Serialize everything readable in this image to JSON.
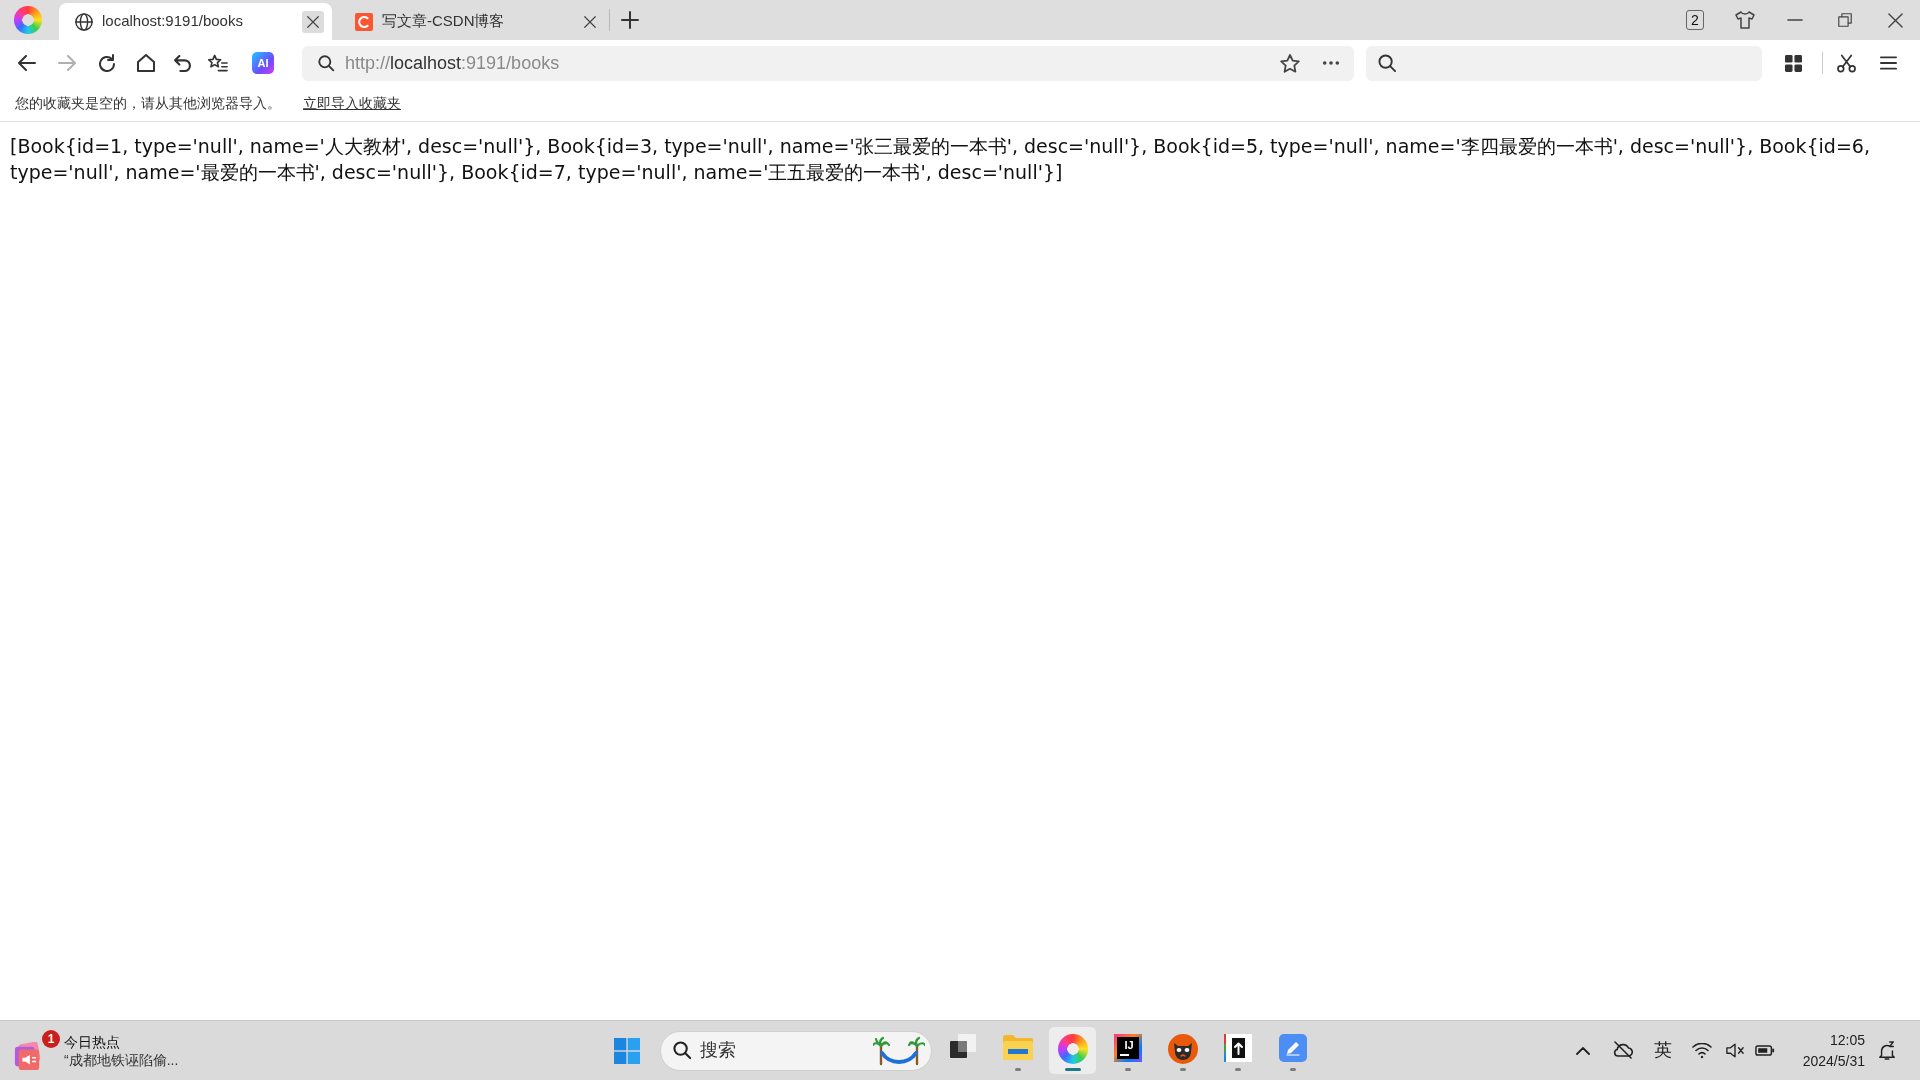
{
  "browser": {
    "tabs": [
      {
        "kind": "globe",
        "title": "localhost:9191/books",
        "selected": true
      },
      {
        "kind": "c-logo",
        "title": "写文章-CSDN博客",
        "selected": false
      }
    ],
    "window_controls": {
      "tab_count": "2"
    },
    "toolbar": {
      "buttons": [
        {
          "kind": "back",
          "disabled": false
        },
        {
          "kind": "forward",
          "disabled": true
        },
        {
          "kind": "reload",
          "disabled": false
        },
        {
          "kind": "home",
          "disabled": false
        },
        {
          "kind": "undo",
          "disabled": false
        },
        {
          "kind": "favorites",
          "disabled": false
        }
      ],
      "ai_button": "AI",
      "address": {
        "scheme": "http://",
        "host": "localhost",
        "path": ":9191/books"
      }
    },
    "bookmarks_bar": {
      "message": "您的收藏夹是空的，请从其他浏览器导入。",
      "link": "立即导入收藏夹"
    }
  },
  "page": {
    "text": "[Book{id=1, type='null', name='人大教材', desc='null'}, Book{id=3, type='null', name='张三最爱的一本书', desc='null'}, Book{id=5, type='null', name='李四最爱的一本书', desc='null'}, Book{id=6, type='null', name='最爱的一本书', desc='null'}, Book{id=7, type='null', name='王五最爱的一本书', desc='null'}]"
  },
  "taskbar": {
    "news": {
      "badge": "1",
      "title": "今日热点",
      "headline": "“成都地铁诬陷偷..."
    },
    "search": {
      "placeholder": "搜索"
    },
    "apps": [
      {
        "kind": "task-view",
        "running": false,
        "selected": false
      },
      {
        "kind": "folder",
        "running": true,
        "selected": false
      },
      {
        "kind": "browser",
        "running": true,
        "selected": true
      },
      {
        "kind": "ide",
        "label": "IJ",
        "running": true,
        "selected": false
      },
      {
        "kind": "cat",
        "running": true,
        "selected": false
      },
      {
        "kind": "arrow-tile",
        "running": true,
        "selected": false
      },
      {
        "kind": "pen",
        "running": true,
        "selected": false
      }
    ],
    "tray": {
      "input_method": "英",
      "time": "12:05",
      "date": "2024/5/31"
    }
  }
}
